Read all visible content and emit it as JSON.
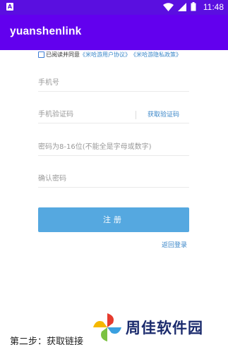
{
  "status_bar": {
    "sim_label": "A",
    "time": "11:48"
  },
  "app_bar": {
    "title": "yuanshenlink"
  },
  "agreement": {
    "prefix": "已阅读并同意",
    "user_agreement": "《米哈游用户协议》",
    "privacy_policy": "《米哈游隐私政策》"
  },
  "form": {
    "phone_placeholder": "手机号",
    "code_placeholder": "手机验证码",
    "get_code_label": "获取验证码",
    "password_placeholder": "密码为8-16位(不能全是字母或数字)",
    "confirm_placeholder": "确认密码",
    "register_label": "注册",
    "back_login_label": "返回登录"
  },
  "footer": {
    "step_text": "第二步：获取链接",
    "watermark_brand": "周佳软件园"
  },
  "colors": {
    "status_bar": "#5a0fe0",
    "app_bar": "#6200ee",
    "register_button": "#55a8e0",
    "link": "#3a86c8"
  },
  "icons": [
    "wifi-icon",
    "signal-icon",
    "battery-icon",
    "checkbox-icon",
    "pinwheel-logo-icon"
  ]
}
